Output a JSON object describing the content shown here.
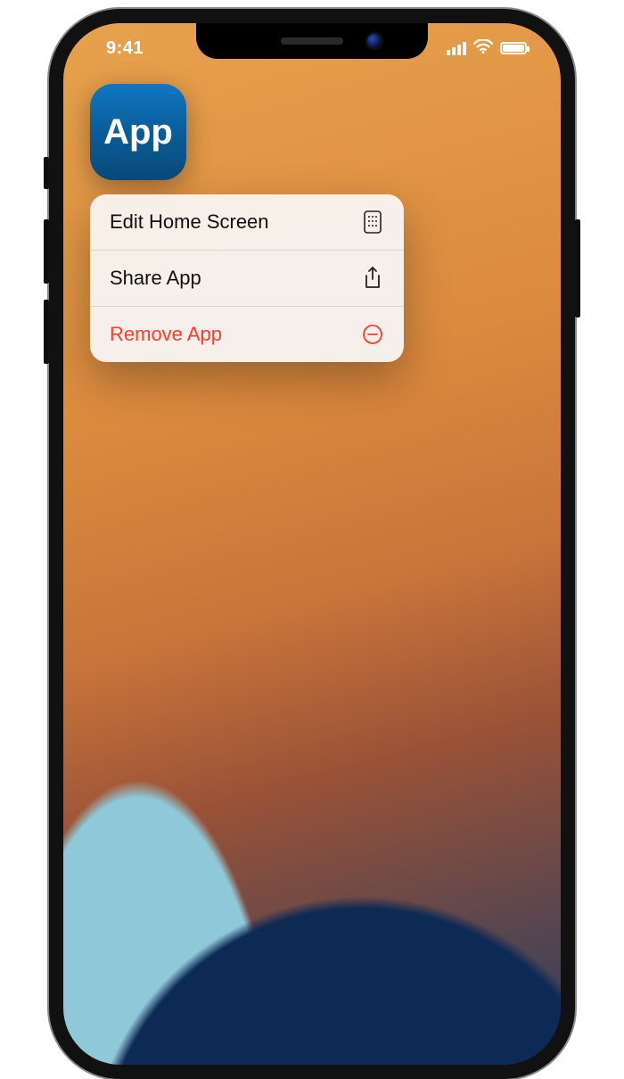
{
  "statusbar": {
    "time": "9:41"
  },
  "app": {
    "label": "App"
  },
  "menu": {
    "items": [
      {
        "label": "Edit Home Screen",
        "icon": "home-grid-icon",
        "destructive": false
      },
      {
        "label": "Share App",
        "icon": "share-icon",
        "destructive": false
      },
      {
        "label": "Remove App",
        "icon": "remove-icon",
        "destructive": true
      }
    ]
  },
  "colors": {
    "destructive": "#ff3b30"
  }
}
